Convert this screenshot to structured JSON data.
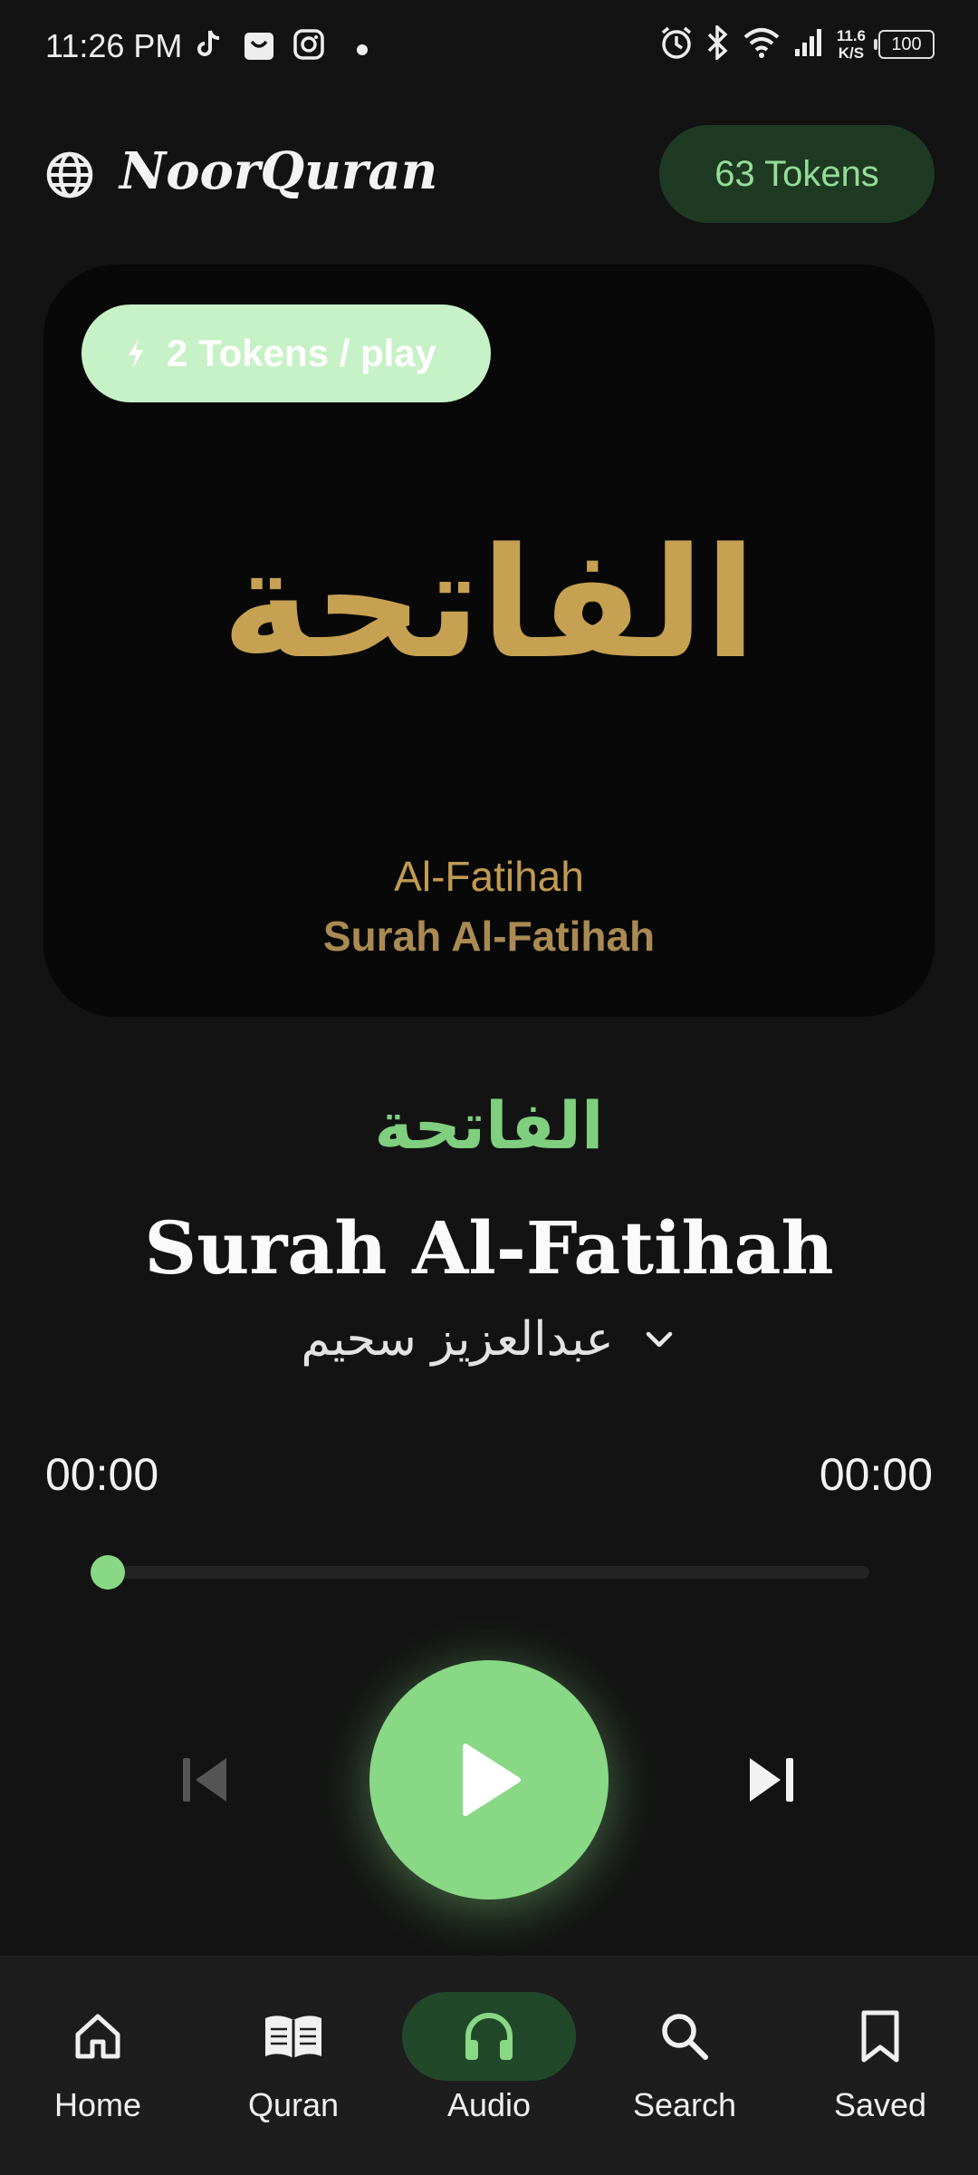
{
  "status_bar": {
    "time": "11:26 PM",
    "net_speed_value": "11.6",
    "net_speed_unit": "K/S",
    "battery": "100"
  },
  "header": {
    "app_name": "NoorQuran",
    "tokens_label": "63 Tokens"
  },
  "card": {
    "cost_label": "2 Tokens / play",
    "arabic_name": "الفاتحة",
    "english_name": "Al-Fatihah",
    "surah_label": "Surah Al-Fatihah"
  },
  "player": {
    "arabic_name": "الفاتحة",
    "title": "Surah Al-Fatihah",
    "reciter": "عبدالعزيز سحيم",
    "current_time": "00:00",
    "total_time": "00:00",
    "progress_fraction": 0
  },
  "nav": {
    "items": [
      {
        "label": "Home",
        "icon": "home-icon"
      },
      {
        "label": "Quran",
        "icon": "book-icon"
      },
      {
        "label": "Audio",
        "icon": "headphones-icon",
        "active": true
      },
      {
        "label": "Search",
        "icon": "search-icon"
      },
      {
        "label": "Saved",
        "icon": "bookmark-icon"
      }
    ]
  },
  "colors": {
    "accent_green": "#88d885",
    "gold": "#c6a152",
    "background": "#131313"
  }
}
